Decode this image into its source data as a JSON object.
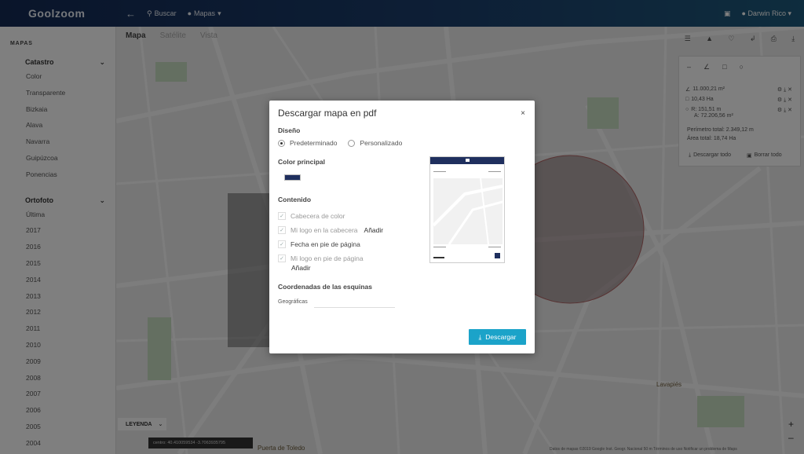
{
  "header": {
    "logo": "Goolzoom",
    "search_label": "Buscar",
    "maps_label": "Mapas",
    "user_name": "Darwin Rico"
  },
  "sidebar": {
    "section_title": "MAPAS",
    "catastro": {
      "label": "Catastro",
      "items": [
        "Color",
        "Transparente",
        "Bizkaia",
        "Alava",
        "Navarra",
        "Guipúzcoa",
        "Ponencias"
      ]
    },
    "ortofoto": {
      "label": "Ortofoto",
      "items": [
        "Última",
        "2017",
        "2016",
        "2015",
        "2014",
        "2013",
        "2012",
        "2011",
        "2010",
        "2009",
        "2008",
        "2007",
        "2006",
        "2005",
        "2004"
      ]
    }
  },
  "map_tabs": [
    "Mapa",
    "Satélite",
    "Vista"
  ],
  "modal": {
    "title": "Descargar mapa en pdf",
    "close": "×",
    "design_title": "Diseño",
    "design_options": [
      "Predeterminado",
      "Personalizado"
    ],
    "color_title": "Color principal",
    "primary_color": "#1f2f5e",
    "content_title": "Contenido",
    "content_items": [
      {
        "label": "Cabecera de color",
        "checked": false
      },
      {
        "label": "Mi logo en la cabecera",
        "checked": false,
        "link": "Añadir"
      },
      {
        "label": "Fecha en pie de página",
        "checked": true
      },
      {
        "label": "Mi logo en pie de página",
        "checked": false,
        "link": "Añadir"
      }
    ],
    "coords_title": "Coordenadas de las esquinas",
    "coords_value": "Geográficas",
    "download_label": "Descargar"
  },
  "right_panel": {
    "rows": [
      {
        "value": "11.000,21 m²"
      },
      {
        "value": "10,43 Ha"
      },
      {
        "value": "R: 151,51 m"
      },
      {
        "value": "A: 72.206,56 m²"
      }
    ],
    "perimeter": "Perímetro total: 2.349,12 m",
    "area": "Área total: 18,74 Ha",
    "download_all": "Descargar todo",
    "delete_all": "Borrar todo"
  },
  "legend_label": "LEYENDA",
  "coords_readout": "centro: 40.410059534 -3.7063935795",
  "places": [
    "Puerta de Toledo",
    "Lavapiés"
  ],
  "attribution": "Datos de mapas ©2019 Google Inst. Geogr. Nacional   50 m   Términos de uso   Notificar un problema de Maps",
  "colors": {
    "header_start": "#142a55",
    "accent": "#1ba3c9",
    "circle_fill": "#7a5f62"
  }
}
